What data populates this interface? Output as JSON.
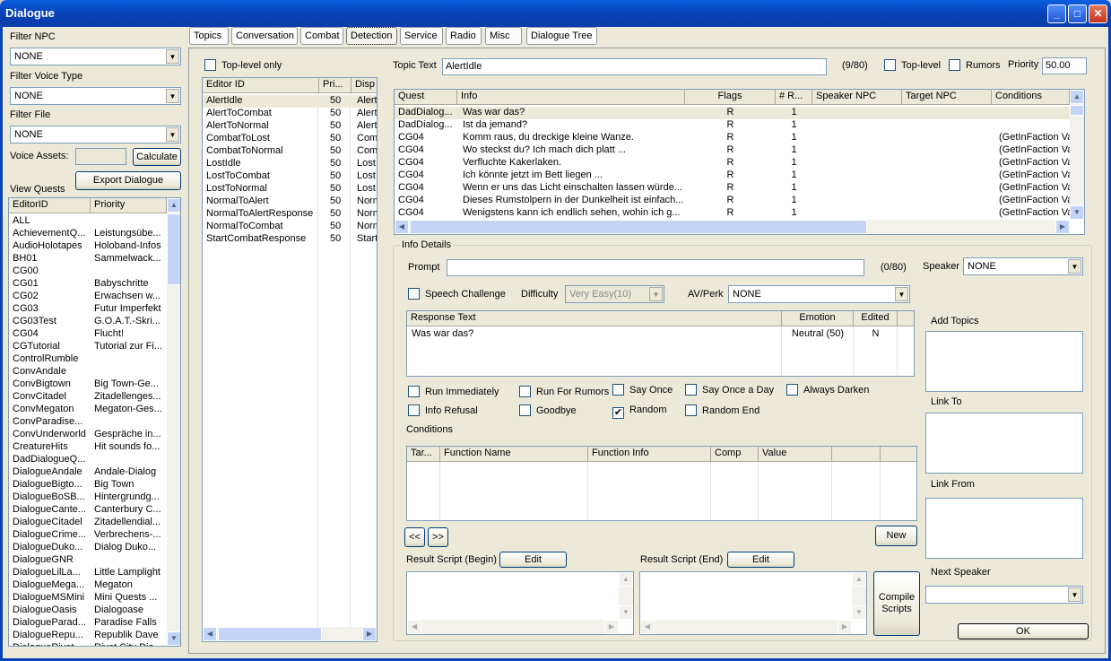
{
  "window": {
    "title": "Dialogue"
  },
  "left": {
    "filter_npc_label": "Filter NPC",
    "filter_npc_value": "NONE",
    "filter_voice_label": "Filter Voice Type",
    "filter_voice_value": "NONE",
    "filter_file_label": "Filter File",
    "filter_file_value": "NONE",
    "voice_assets_label": "Voice Assets:",
    "calculate": "Calculate",
    "export": "Export Dialogue",
    "view_quests_label": "View Quests",
    "quest_cols": [
      "EditorID",
      "Priority"
    ],
    "quests": [
      [
        "ALL",
        ""
      ],
      [
        "AchievementQ...",
        "Leistungsübe..."
      ],
      [
        "AudioHolotapes",
        "Holoband-Infos"
      ],
      [
        "BH01",
        "Sammelwack..."
      ],
      [
        "CG00",
        ""
      ],
      [
        "CG01",
        "Babyschritte"
      ],
      [
        "CG02",
        "Erwachsen w..."
      ],
      [
        "CG03",
        "Futur Imperfekt"
      ],
      [
        "CG03Test",
        "G.O.A.T.-Skri..."
      ],
      [
        "CG04",
        "Flucht!"
      ],
      [
        "CGTutorial",
        "Tutorial zur Fi..."
      ],
      [
        "ControlRumble",
        ""
      ],
      [
        "ConvAndale",
        ""
      ],
      [
        "ConvBigtown",
        "Big Town-Ge..."
      ],
      [
        "ConvCitadel",
        "Zitadellenges..."
      ],
      [
        "ConvMegaton",
        "Megaton-Ges..."
      ],
      [
        "ConvParadise...",
        ""
      ],
      [
        "ConvUnderworld",
        "Gespräche in..."
      ],
      [
        "CreatureHits",
        "Hit sounds fo..."
      ],
      [
        "DadDialogueQ...",
        ""
      ],
      [
        "DialogueAndale",
        "Andale-Dialog"
      ],
      [
        "DialogueBigto...",
        "Big Town"
      ],
      [
        "DialogueBoSB...",
        "Hintergrundg..."
      ],
      [
        "DialogueCante...",
        "Canterbury C..."
      ],
      [
        "DialogueCitadel",
        "Zitadellendial..."
      ],
      [
        "DialogueCrime...",
        "Verbrechens-..."
      ],
      [
        "DialogueDuko...",
        "Dialog Duko..."
      ],
      [
        "DialogueGNR",
        ""
      ],
      [
        "DialogueLilLa...",
        "Little Lamplight"
      ],
      [
        "DialogueMega...",
        "Megaton"
      ],
      [
        "DialogueMSMini",
        "Mini Quests ..."
      ],
      [
        "DialogueOasis",
        "Dialogoase"
      ],
      [
        "DialogueParad...",
        "Paradise Falls"
      ],
      [
        "DialogueRepu...",
        "Republik Dave"
      ],
      [
        "DialogueRivet...",
        "Rivet City Dia..."
      ]
    ]
  },
  "tabs": [
    "Topics",
    "Conversation",
    "Combat",
    "Detection",
    "Service",
    "Radio",
    "Misc",
    "Dialogue Tree"
  ],
  "topics": {
    "toplevel_only": "Top-level only",
    "cols": [
      "Editor ID",
      "Pri...",
      "Disp"
    ],
    "rows": [
      [
        "AlertIdle",
        "50",
        "Alert"
      ],
      [
        "AlertToCombat",
        "50",
        "Alert"
      ],
      [
        "AlertToNormal",
        "50",
        "Alert"
      ],
      [
        "CombatToLost",
        "50",
        "Com"
      ],
      [
        "CombatToNormal",
        "50",
        "Com"
      ],
      [
        "LostIdle",
        "50",
        "Lost"
      ],
      [
        "LostToCombat",
        "50",
        "Lost"
      ],
      [
        "LostToNormal",
        "50",
        "Lost"
      ],
      [
        "NormalToAlert",
        "50",
        "Norm"
      ],
      [
        "NormalToAlertResponse",
        "50",
        "Norm"
      ],
      [
        "NormalToCombat",
        "50",
        "Norm"
      ],
      [
        "StartCombatResponse",
        "50",
        "Start"
      ]
    ]
  },
  "topic_text": {
    "label": "Topic Text",
    "value": "AlertIdle",
    "count": "(9/80)",
    "toplevel": "Top-level",
    "rumors": "Rumors",
    "priority_label": "Priority",
    "priority_value": "50.00"
  },
  "info_table": {
    "cols": [
      "Quest",
      "Info",
      "Flags",
      "# R...",
      "Speaker NPC",
      "Target NPC",
      "Conditions"
    ],
    "rows": [
      [
        "DadDialog...",
        "Was war das?",
        "R",
        "1",
        ""
      ],
      [
        "DadDialog...",
        "Ist da jemand?",
        "R",
        "1",
        ""
      ],
      [
        "CG04",
        "Komm raus, du dreckige kleine Wanze.",
        "R",
        "1",
        "(GetInFaction Va"
      ],
      [
        "CG04",
        "Wo steckst du? Ich mach dich platt ...",
        "R",
        "1",
        "(GetInFaction Va"
      ],
      [
        "CG04",
        "Verfluchte Kakerlaken.",
        "R",
        "1",
        "(GetInFaction Va"
      ],
      [
        "CG04",
        "Ich könnte jetzt im Bett liegen ...",
        "R",
        "1",
        "(GetInFaction Va"
      ],
      [
        "CG04",
        "Wenn er uns das Licht einschalten lassen würde...",
        "R",
        "1",
        "(GetInFaction Va"
      ],
      [
        "CG04",
        "Dieses Rumstolpern in der Dunkelheit ist einfach...",
        "R",
        "1",
        "(GetInFaction Va"
      ],
      [
        "CG04",
        "Wenigstens kann ich endlich sehen, wohin ich g...",
        "R",
        "1",
        "(GetInFaction Va"
      ]
    ]
  },
  "details": {
    "group_label": "Info Details",
    "prompt_label": "Prompt",
    "prompt_count": "(0/80)",
    "speaker_label": "Speaker",
    "speaker_value": "NONE",
    "speech_challenge": "Speech Challenge",
    "difficulty_label": "Difficulty",
    "difficulty_value": "Very Easy(10)",
    "avperk_label": "AV/Perk",
    "avperk_value": "NONE",
    "resp_cols": [
      "Response Text",
      "Emotion",
      "Edited"
    ],
    "resp_row": [
      "Was war das?",
      "Neutral (50)",
      "N"
    ],
    "add_topics": "Add Topics",
    "link_to": "Link To",
    "link_from": "Link From",
    "next_speaker": "Next Speaker",
    "checks": [
      "Run Immediately",
      "Run For Rumors",
      "Say Once",
      "Say Once a Day",
      "Always Darken",
      "Info Refusal",
      "Goodbye",
      "Random",
      "Random End"
    ],
    "random_checked": "✔",
    "conditions_label": "Conditions",
    "cond_cols": [
      "Tar...",
      "Function Name",
      "Function Info",
      "Comp",
      "Value"
    ],
    "prev": "<<",
    "next": ">>",
    "new": "New",
    "result_begin": "Result Script (Begin)",
    "result_end": "Result Script (End)",
    "edit": "Edit",
    "compile": "Compile Scripts",
    "ok": "OK"
  }
}
